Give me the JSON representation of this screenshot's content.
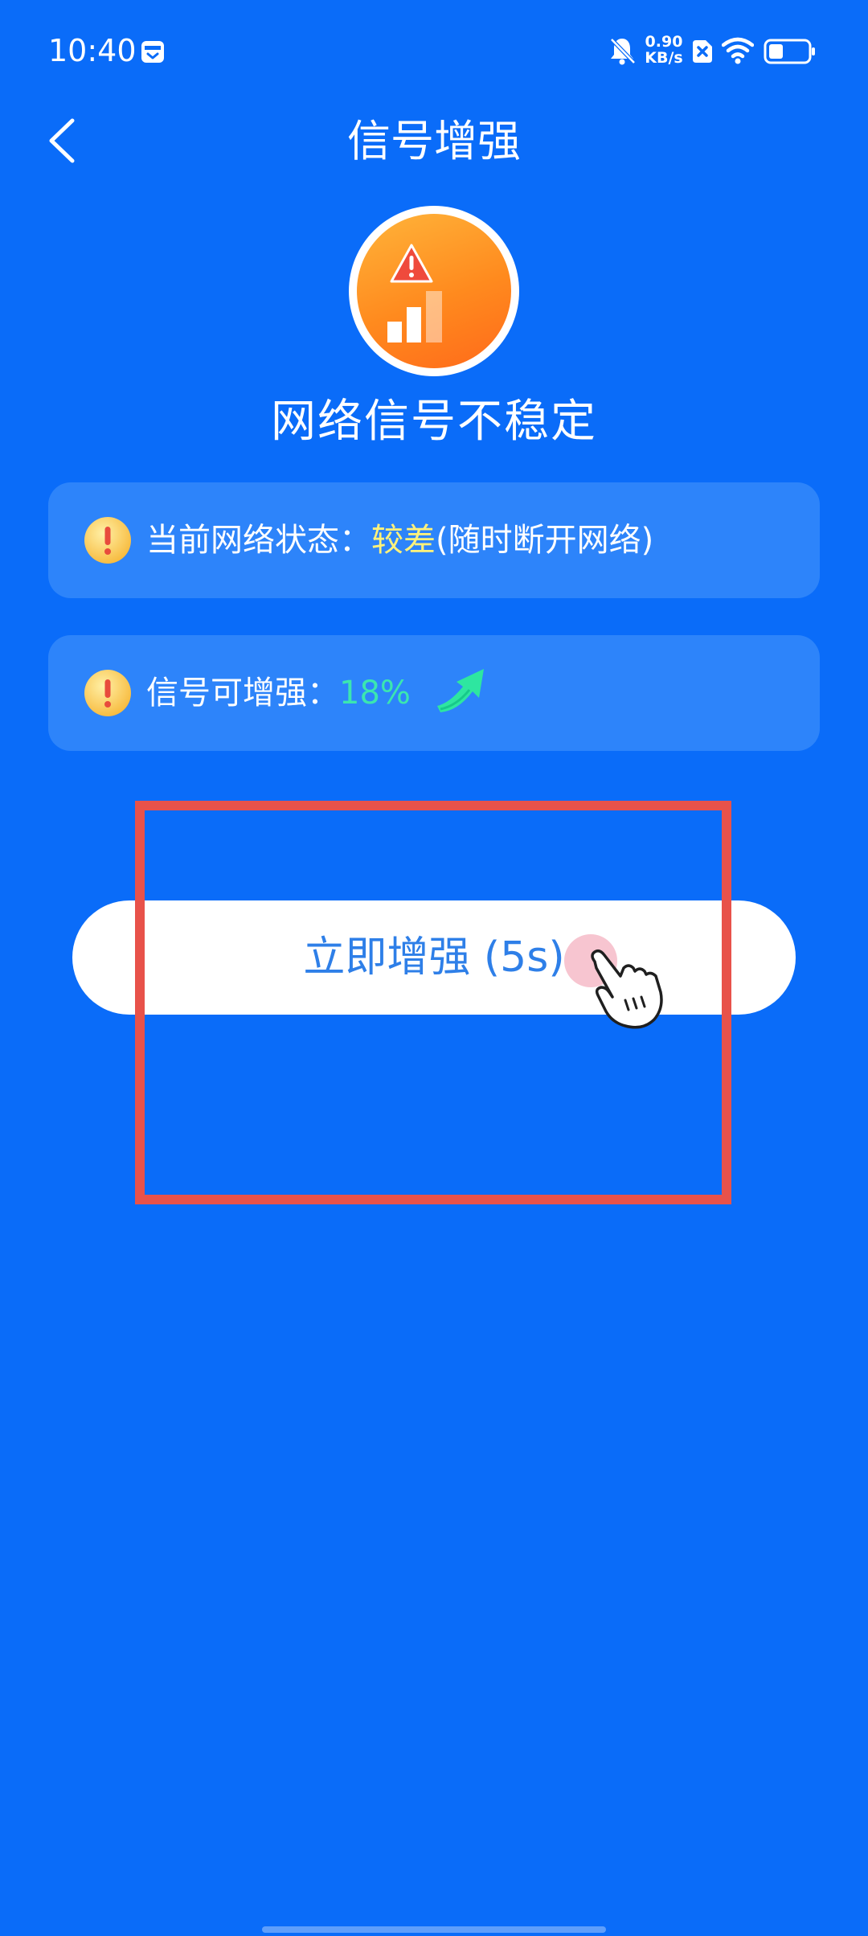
{
  "status_bar": {
    "time": "10:40",
    "network_speed_value": "0.90",
    "network_speed_unit": "KB/s",
    "icons": [
      "calendar-icon",
      "bell-muted-icon",
      "sim-off-icon",
      "wifi-icon",
      "battery-icon"
    ]
  },
  "header": {
    "title": "信号增强",
    "back_icon": "chevron-left-icon"
  },
  "signal_badge": {
    "icons": [
      "warning-triangle-icon",
      "signal-bars-icon"
    ]
  },
  "headline": "网络信号不稳定",
  "cards": [
    {
      "icon": "exclamation-icon",
      "label": "当前网络状态：",
      "value": "较差",
      "detail": "(随时断开网络)"
    },
    {
      "icon": "exclamation-icon",
      "label": "信号可增强：",
      "value": "18%",
      "trailing_icon": "up-arrow-icon"
    }
  ],
  "boost_button": {
    "label": "立即增强",
    "countdown": "(5s)"
  },
  "colors": {
    "background": "#0A6CF9",
    "card": "#2D84FA",
    "value_yellow": "#FFF27A",
    "value_green": "#3BE6B0",
    "button_text": "#2E7FE8",
    "highlight_frame": "#E8524A"
  }
}
